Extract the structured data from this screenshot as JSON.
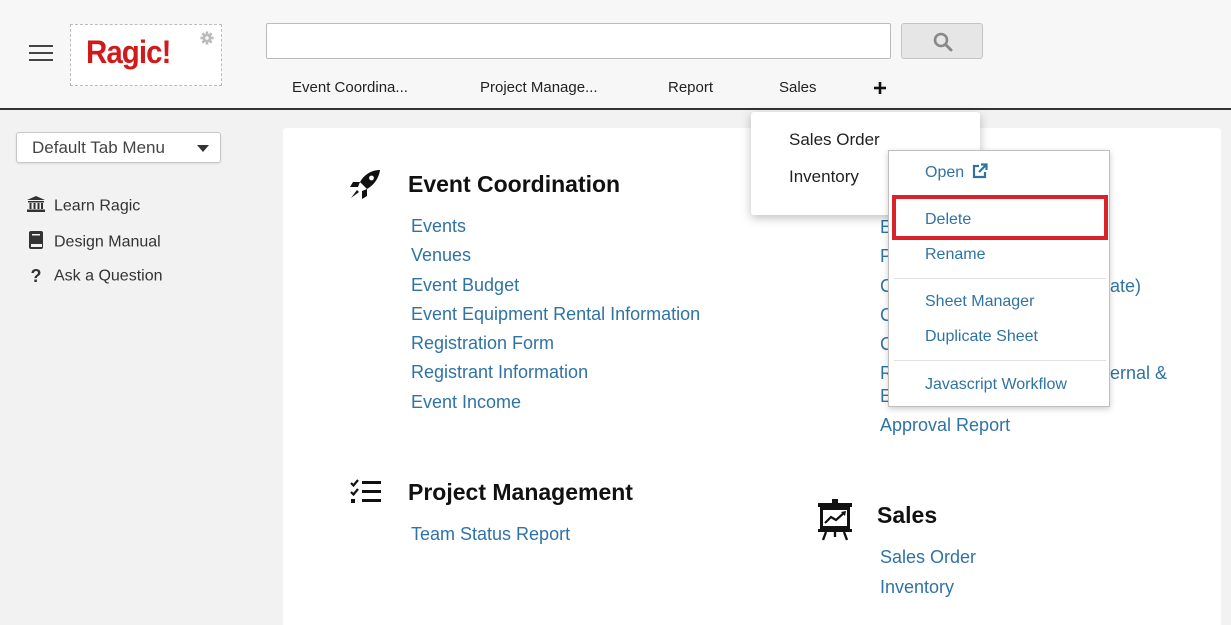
{
  "header": {
    "logo_text": "Ragic!",
    "search": {
      "value": "",
      "placeholder": ""
    },
    "tabs": [
      {
        "label": "Event Coordina..."
      },
      {
        "label": "Project Manage..."
      },
      {
        "label": "Report"
      },
      {
        "label": "Sales"
      }
    ],
    "add_tab_icon": "plus-icon"
  },
  "sidebar": {
    "dropdown_label": "Default Tab Menu",
    "links": [
      {
        "label": "Learn Ragic",
        "icon": "university-icon"
      },
      {
        "label": "Design Manual",
        "icon": "book-icon"
      },
      {
        "label": "Ask a Question",
        "icon": "question-icon"
      }
    ]
  },
  "sections": {
    "event": {
      "title": "Event Coordination",
      "links": [
        "Events",
        "Venues",
        "Event Budget",
        "Event Equipment Rental Information",
        "Registration Form",
        "Registrant Information",
        "Event Income"
      ]
    },
    "project": {
      "title": "Project Management",
      "links": [
        "Team Status Report"
      ]
    },
    "report": {
      "partial_links": [
        "E",
        "P",
        "C",
        "C",
        "C",
        "R",
        "E"
      ],
      "partial_suffix_1": "ate)",
      "partial_suffix_2": "ernal &",
      "approval_link": "Approval Report"
    },
    "sales": {
      "title": "Sales",
      "links": [
        "Sales Order",
        "Inventory"
      ]
    }
  },
  "sales_menu": {
    "items": [
      "Sales Order",
      "Inventory"
    ]
  },
  "context_menu": {
    "open": "Open",
    "delete": "Delete",
    "rename": "Rename",
    "sheet_manager": "Sheet Manager",
    "duplicate_sheet": "Duplicate Sheet",
    "javascript_workflow": "Javascript Workflow"
  },
  "colors": {
    "link": "#2f73a5",
    "highlight": "#d9222a",
    "logo": "#d11a1a"
  }
}
